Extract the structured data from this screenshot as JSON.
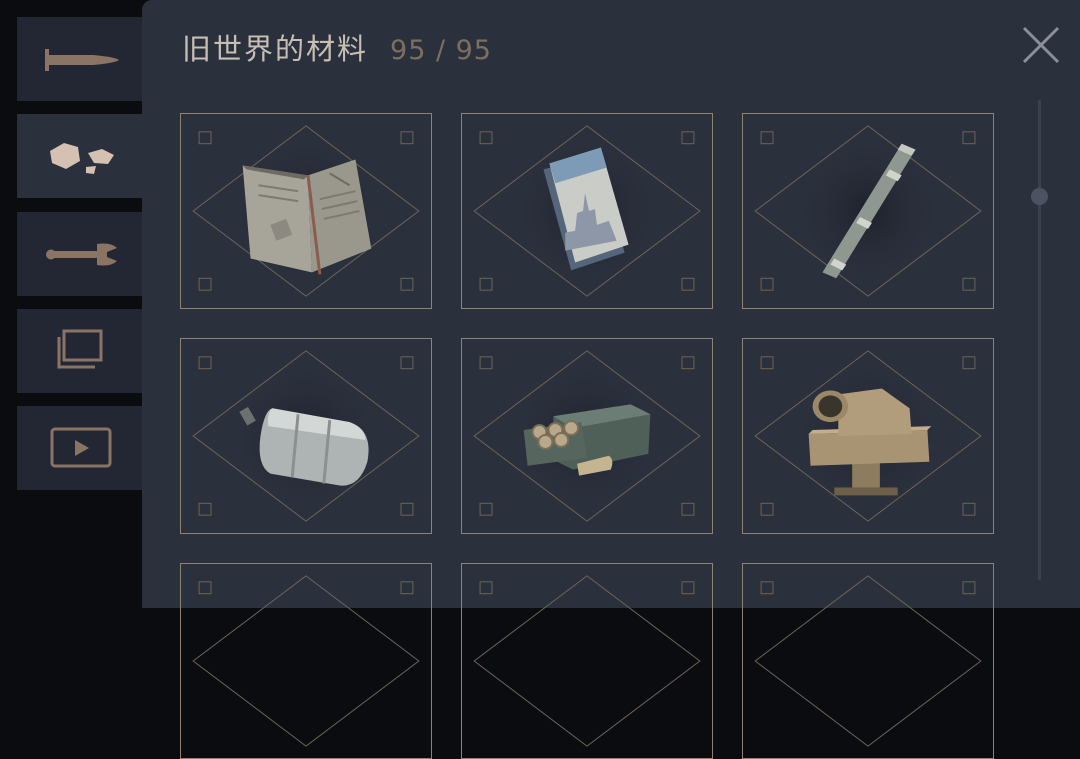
{
  "sidebar": {
    "tabs": [
      {
        "icon": "bullet-icon",
        "active": false
      },
      {
        "icon": "materials-icon",
        "active": true
      },
      {
        "icon": "wrench-icon",
        "active": false
      },
      {
        "icon": "gallery-icon",
        "active": false
      },
      {
        "icon": "video-icon",
        "active": false
      }
    ]
  },
  "panel": {
    "title": "旧世界的材料",
    "count": "95 / 95",
    "close_icon": "close-icon"
  },
  "grid": {
    "items": [
      {
        "icon": "book-icon"
      },
      {
        "icon": "postcard-icon"
      },
      {
        "icon": "metal-rod-icon"
      },
      {
        "icon": "gas-canister-icon"
      },
      {
        "icon": "ammo-box-icon"
      },
      {
        "icon": "periscope-icon"
      },
      {
        "icon": "unknown-item-icon"
      },
      {
        "icon": "unknown-item-icon"
      },
      {
        "icon": "unknown-item-icon"
      }
    ]
  },
  "colors": {
    "panel_bg": "#2b303d",
    "card_border": "#8f8274",
    "title_text": "#c7bfb4",
    "count_text": "#7c6f61",
    "tab_icon": "#8a7565",
    "tab_icon_active": "#d4c1b2"
  }
}
